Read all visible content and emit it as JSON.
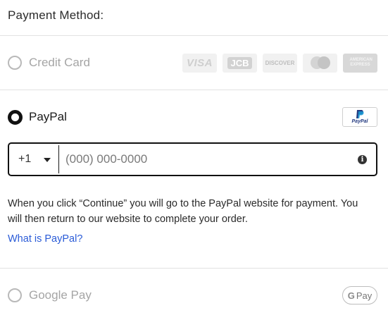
{
  "title": "Payment Method:",
  "options": {
    "credit_card": {
      "label": "Credit Card",
      "selected": false,
      "cards": [
        {
          "name": "visa-logo",
          "text": "VISA"
        },
        {
          "name": "jcb-logo",
          "text": "JCB"
        },
        {
          "name": "discover-logo",
          "text": "DISCOVER"
        },
        {
          "name": "mastercard-logo",
          "text": ""
        },
        {
          "name": "amex-logo",
          "text": "AMERICAN EXPRESS"
        }
      ]
    },
    "paypal": {
      "label": "PayPal",
      "selected": true,
      "logo_text": "PayPal",
      "country_code": "+1",
      "phone_placeholder": "(000) 000-0000",
      "info_icon": "i",
      "message": "When you click “Continue” you will go to the PayPal website for payment. You will then return to our website to complete your order.",
      "link": "What is PayPal?"
    },
    "google_pay": {
      "label": "Google Pay",
      "selected": false,
      "badge_g": "G",
      "badge_text": "Pay"
    }
  },
  "colors": {
    "link": "#2a5bd7",
    "disabled_text": "#a5a5a5",
    "border_active": "#111111",
    "divider": "#e2e2e2"
  },
  "icons": [
    "caret-down-icon",
    "info-icon",
    "paypal-icon",
    "google-g-icon"
  ]
}
